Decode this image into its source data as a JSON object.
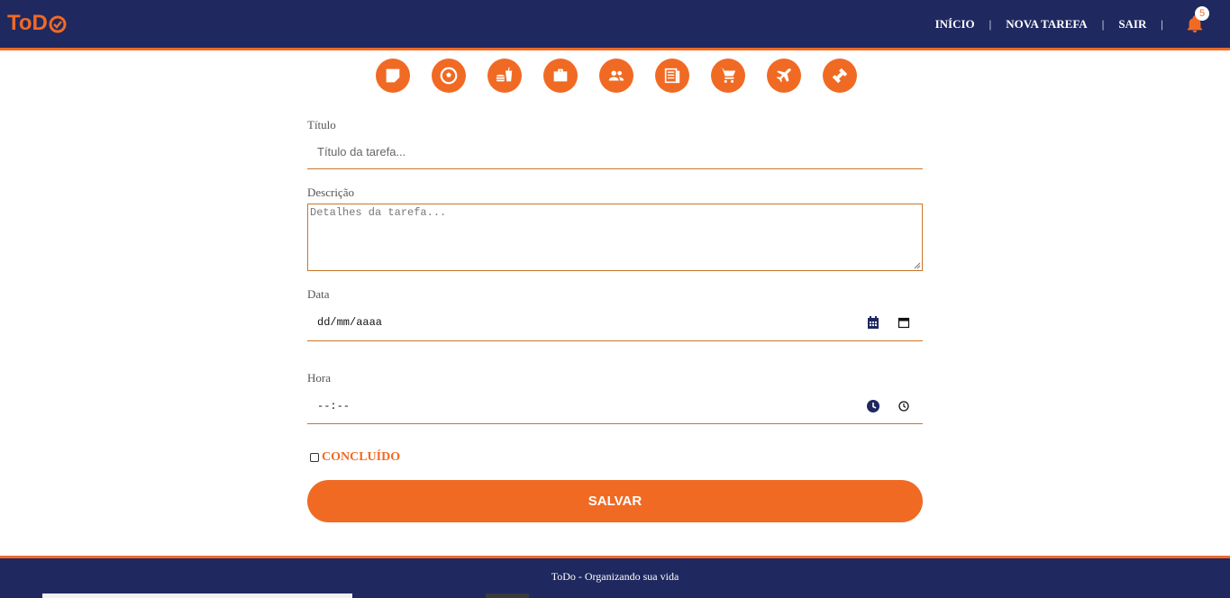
{
  "brand": {
    "logo_text": "ToD",
    "accent": "#f06a24",
    "navy": "#1f285f"
  },
  "nav": {
    "items": [
      "INÍCIO",
      "NOVA TAREFA",
      "SAIR"
    ],
    "separator": "|",
    "notifications": {
      "icon": "bell-icon",
      "count": "5"
    }
  },
  "categories": [
    "note-icon",
    "soccer-ball-icon",
    "fastfood-icon",
    "briefcase-icon",
    "people-icon",
    "newspaper-icon",
    "shopping-cart-icon",
    "airplane-icon",
    "dumbbell-icon"
  ],
  "form": {
    "title": {
      "label": "Título",
      "placeholder": "Título da tarefa..."
    },
    "description": {
      "label": "Descrição",
      "placeholder": "Detalhes da tarefa..."
    },
    "date": {
      "label": "Data",
      "value": "dd/mm/aaaa"
    },
    "time": {
      "label": "Hora",
      "value": "--:--"
    },
    "done": {
      "label": "CONCLUÍDO"
    },
    "save_label": "SALVAR"
  },
  "footer": {
    "text": "ToDo - Organizando sua vida"
  }
}
